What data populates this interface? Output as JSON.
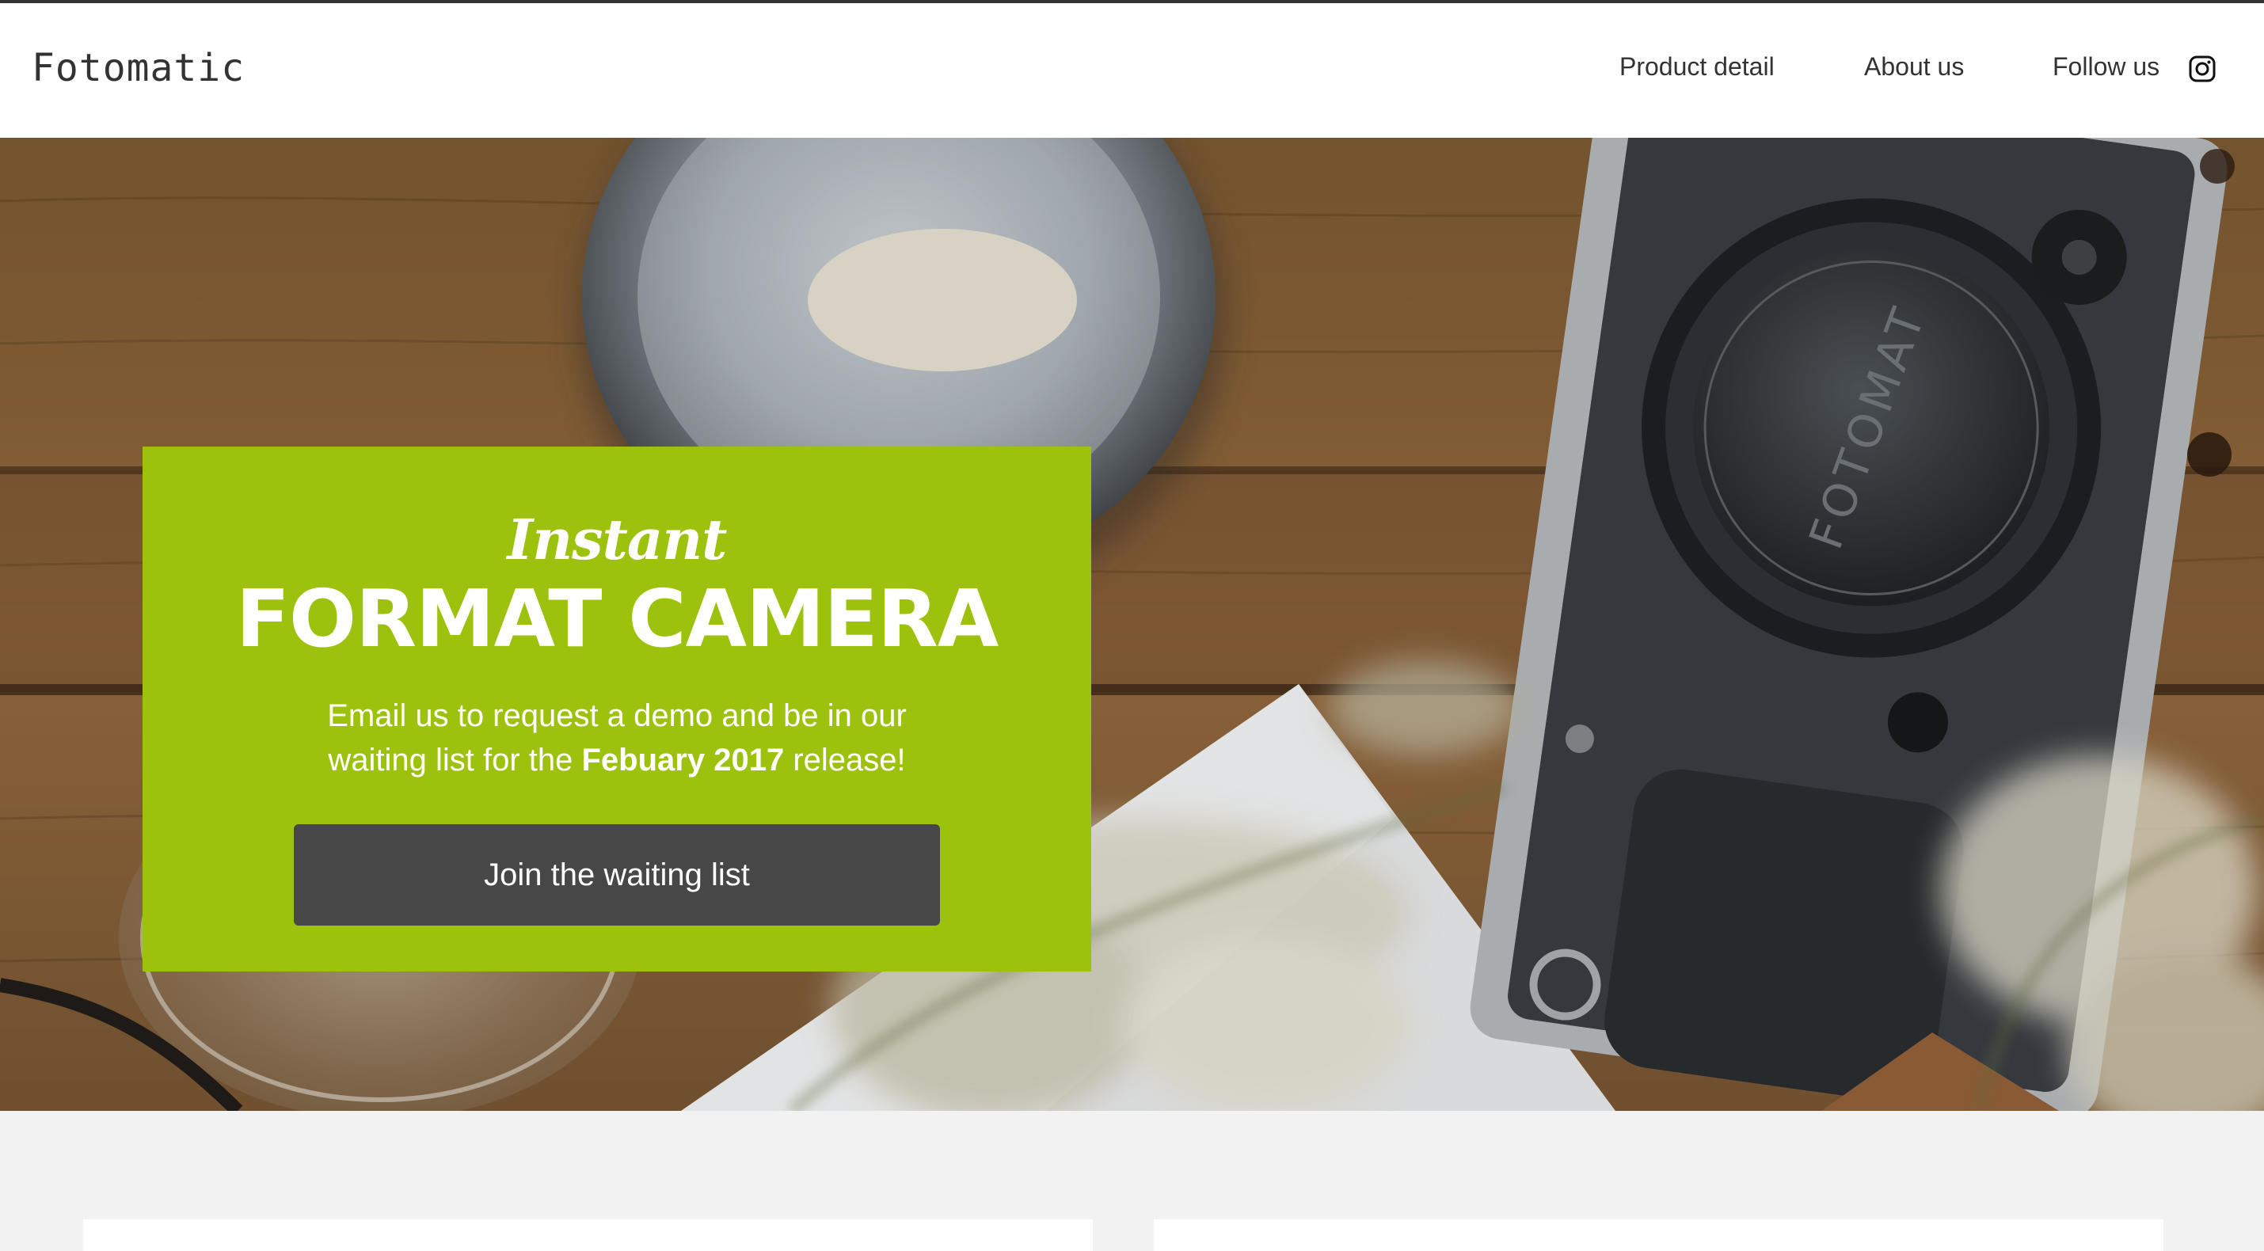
{
  "header": {
    "brand": "Fotomatic",
    "nav": {
      "product_detail": "Product detail",
      "about_us": "About us",
      "follow_us": "Follow us"
    },
    "social_icon": "instagram-icon"
  },
  "hero": {
    "promo": {
      "script_heading": "Instant",
      "title": "FORMAT CAMERA",
      "text_before": "Email us to request a demo and be in our waiting list for the ",
      "text_strong": "Febuary 2017",
      "text_after": " release!",
      "button_label": "Join the waiting list"
    },
    "camera_cap_text": "FOTOMAT"
  },
  "colors": {
    "promo_green": "#9dc20d",
    "button_dark": "#474747",
    "page_bg": "#f2f2f2",
    "header_bg": "#ffffff"
  }
}
